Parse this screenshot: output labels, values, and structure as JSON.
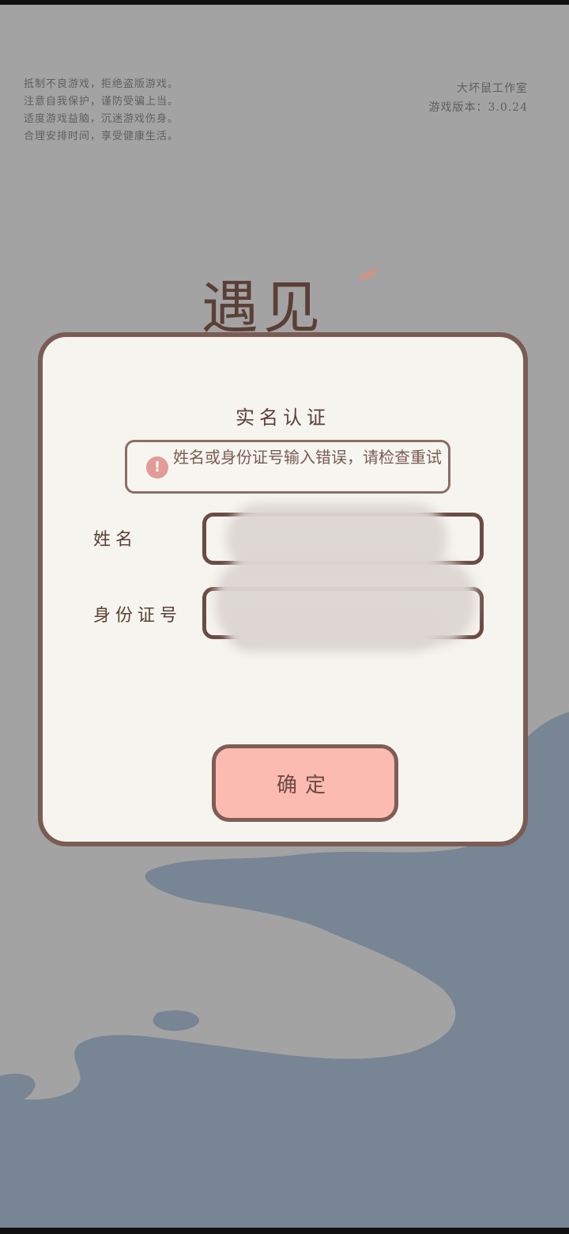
{
  "notice": {
    "lines": [
      "抵制不良游戏，拒绝盗版游戏。",
      "注意自我保护，谨防受骗上当。",
      "适度游戏益脑，沉迷游戏伤身。",
      "合理安排时间，享受健康生活。"
    ]
  },
  "studio": {
    "name": "大坏鼠工作室",
    "version": "游戏版本：3.0.24"
  },
  "logo": {
    "text": "遇见"
  },
  "dialog": {
    "title": "实名认证",
    "error": "姓名或身份证号输入错误，请检查重试",
    "name_label": "姓名",
    "id_label": "身份证号",
    "name_value": "",
    "id_value": "",
    "confirm_label": "确定"
  },
  "colors": {
    "background": "#a3a3a3",
    "dialog_bg": "#f6f4ee",
    "border": "#7b5c54",
    "button": "#fcbbb0",
    "error_icon": "#e29b96",
    "water": "#778594"
  }
}
